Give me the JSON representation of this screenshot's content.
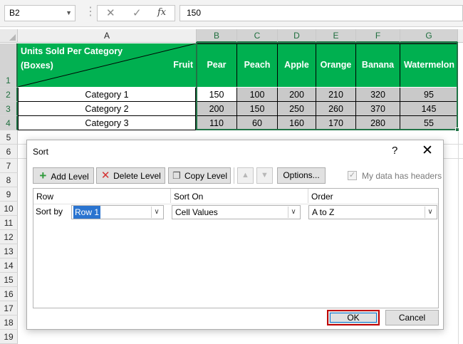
{
  "formula_bar": {
    "name_box": "B2",
    "cancel_icon": "x-icon",
    "enter_icon": "check-icon",
    "fx_label": "fx",
    "value": "150"
  },
  "grid": {
    "columns": [
      "A",
      "B",
      "C",
      "D",
      "E",
      "F",
      "G"
    ],
    "rows": [
      "1",
      "2",
      "3",
      "4",
      "5",
      "6",
      "7",
      "8",
      "9",
      "10",
      "11",
      "12",
      "13",
      "14",
      "15",
      "16",
      "17",
      "18",
      "19"
    ],
    "header_left_line1": "Units Sold Per Category",
    "header_left_line2": "(Boxes)",
    "header_right": "Fruit",
    "fruits": [
      "Pear",
      "Peach",
      "Apple",
      "Orange",
      "Banana",
      "Watermelon"
    ],
    "categories": [
      "Category 1",
      "Category 2",
      "Category 3"
    ],
    "values": [
      [
        "150",
        "100",
        "200",
        "210",
        "320",
        "95"
      ],
      [
        "200",
        "150",
        "250",
        "260",
        "370",
        "145"
      ],
      [
        "110",
        "60",
        "160",
        "170",
        "280",
        "55"
      ]
    ],
    "header_fill": "#00b050",
    "data_fill": "#c9c9c9"
  },
  "sort_dialog": {
    "title": "Sort",
    "help": "?",
    "close": "✕",
    "add_level": "Add Level",
    "delete_level": "Delete Level",
    "copy_level": "Copy Level",
    "move_up": "▲",
    "move_down": "▼",
    "options": "Options...",
    "headers_checkbox_label": "My data has headers",
    "headers_checked": true,
    "col_row": "Row",
    "col_sort_on": "Sort On",
    "col_order": "Order",
    "sort_by_label": "Sort by",
    "sort_by_value": "Row 1",
    "sort_on_value": "Cell Values",
    "order_value": "A to Z",
    "ok": "OK",
    "cancel": "Cancel"
  }
}
